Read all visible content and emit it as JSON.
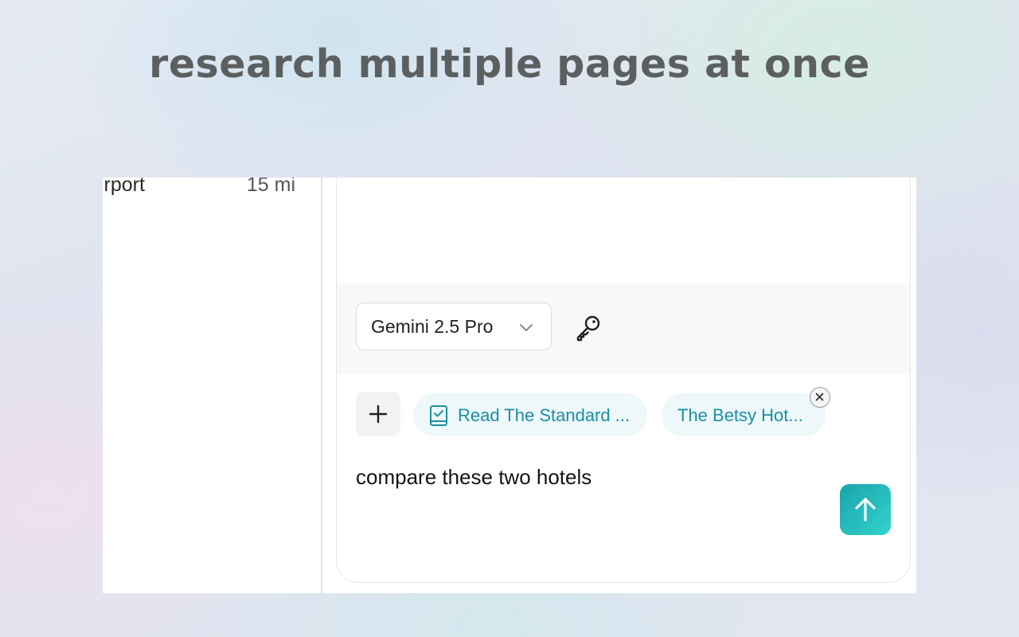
{
  "headline": "research multiple pages at once",
  "left_pane": {
    "row_label": "irport",
    "row_value": "15 mi"
  },
  "composer": {
    "model_selector": {
      "selected": "Gemini 2.5 Pro",
      "icon": "chevron-down-icon"
    },
    "api_key_icon": "key-icon",
    "add_context_icon": "plus-icon",
    "context_chips": [
      {
        "label": "Read The Standard ...",
        "icon": "book-check-icon"
      },
      {
        "label": "The Betsy Hot..."
      }
    ],
    "remove_chip_icon": "close-icon",
    "message_text": "compare these two hotels",
    "send_icon": "arrow-up-icon"
  },
  "colors": {
    "headline": "#5c5f60",
    "chip_text": "#1a8fa3",
    "chip_bg": "#eef8fa",
    "send_gradient_start": "#1aa4ab",
    "send_gradient_end": "#33d3cd"
  }
}
